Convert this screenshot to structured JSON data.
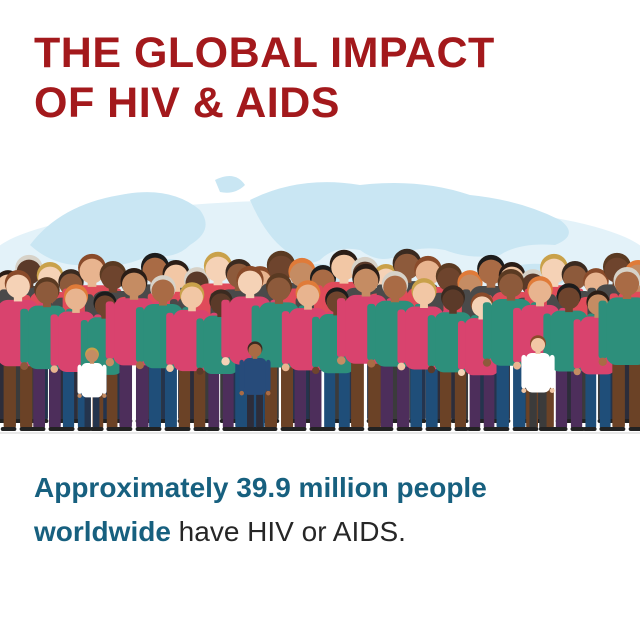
{
  "header": {
    "title_line1": "THE GLOBAL IMPACT",
    "title_line2": "OF HIV & AIDS"
  },
  "illustration": {
    "map_name": "world-map-icon",
    "crowd_name": "diverse-crowd-illustration"
  },
  "caption": {
    "highlight": "Approximately 39.9 million people worldwide",
    "rest": " have HIV or AIDS."
  },
  "colors": {
    "title": "#a3191c",
    "highlight": "#17607f",
    "body_text": "#262626",
    "map": "#c9e6f3"
  }
}
